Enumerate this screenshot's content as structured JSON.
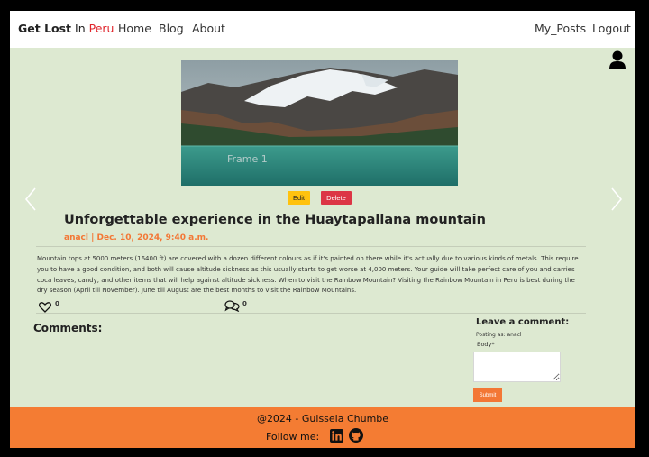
{
  "navbar": {
    "brand_part1": "Get Lost",
    "brand_part2": " In ",
    "brand_part3": "Peru",
    "links": [
      "Home",
      "Blog",
      "About"
    ],
    "right_links": [
      "My_Posts",
      "Logout"
    ]
  },
  "carousel": {
    "caption": "Frame 1"
  },
  "post": {
    "edit_label": "Edit",
    "delete_label": "Delete",
    "title": "Unforgettable experience in the Huaytapallana mountain",
    "meta": "anacl | Dec. 10, 2024, 9:40 a.m.",
    "body": "Mountain tops at 5000 meters (16400 ft) are covered with a dozen different colours as if it's painted on there while it's actually due to various kinds of metals. This require you to have a good condition, and both will cause altitude sickness as this usually starts to get worse at 4,000 meters. Your guide will take perfect care of you and carries coca leaves, candy, and other items that will help against altitude sickness. When to visit the Rainbow Mountain? Visiting the Rainbow Mountain in Peru is best during the dry season (April till November). June till August are the best months to visit the Rainbow Mountains.",
    "likes": "0",
    "comments": "0"
  },
  "comments": {
    "heading": "Comments:"
  },
  "comment_form": {
    "heading": "Leave a comment:",
    "posting_as": "Posting as: anacl",
    "body_label": "Body*",
    "submit_label": "Submit"
  },
  "footer": {
    "copyright": "@2024 - Guissela Chumbe",
    "follow": "Follow me:"
  },
  "colors": {
    "background": "#dde9d1",
    "accent": "#f47c33",
    "brand_red": "#e0242b",
    "edit_button": "#ffc20e",
    "delete_button": "#dc3545"
  },
  "icons": [
    "user-icon",
    "chevron-left-icon",
    "chevron-right-icon",
    "heart-icon",
    "comments-icon",
    "linkedin-icon",
    "github-icon"
  ]
}
